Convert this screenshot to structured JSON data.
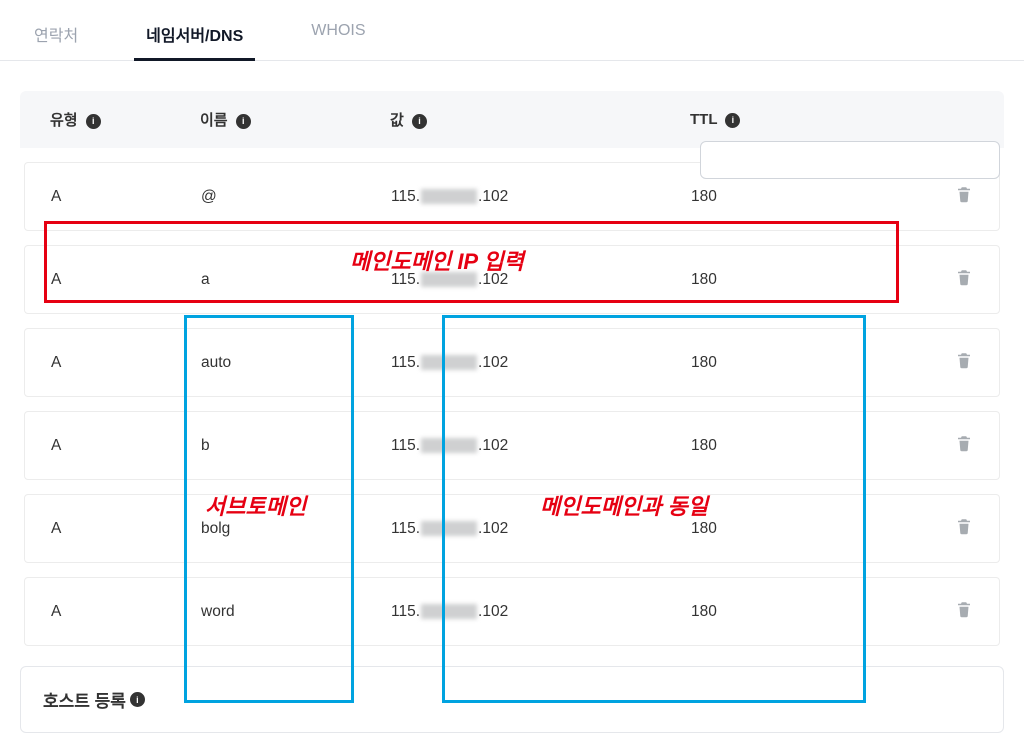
{
  "tabs": {
    "contact": "연락처",
    "dns": "네임서버/DNS",
    "whois": "WHOIS"
  },
  "headers": {
    "type": "유형",
    "name": "이름",
    "value": "값",
    "ttl": "TTL"
  },
  "records": [
    {
      "type": "A",
      "name": "@",
      "value_left": "115.",
      "value_right": ".102",
      "ttl": "180"
    },
    {
      "type": "A",
      "name": "a",
      "value_left": "115.",
      "value_right": ".102",
      "ttl": "180"
    },
    {
      "type": "A",
      "name": "auto",
      "value_left": "115.",
      "value_right": ".102",
      "ttl": "180"
    },
    {
      "type": "A",
      "name": "b",
      "value_left": "115.",
      "value_right": ".102",
      "ttl": "180"
    },
    {
      "type": "A",
      "name": "bolg",
      "value_left": "115.",
      "value_right": ".102",
      "ttl": "180"
    },
    {
      "type": "A",
      "name": "word",
      "value_left": "115.",
      "value_right": ".102",
      "ttl": "180"
    }
  ],
  "annotations": {
    "main_ip": "메인도메인 IP 입력",
    "subdomain": "서브토메인",
    "same_as_main": "메인도메인과 동일"
  },
  "host_section_title": "호스트 등록"
}
